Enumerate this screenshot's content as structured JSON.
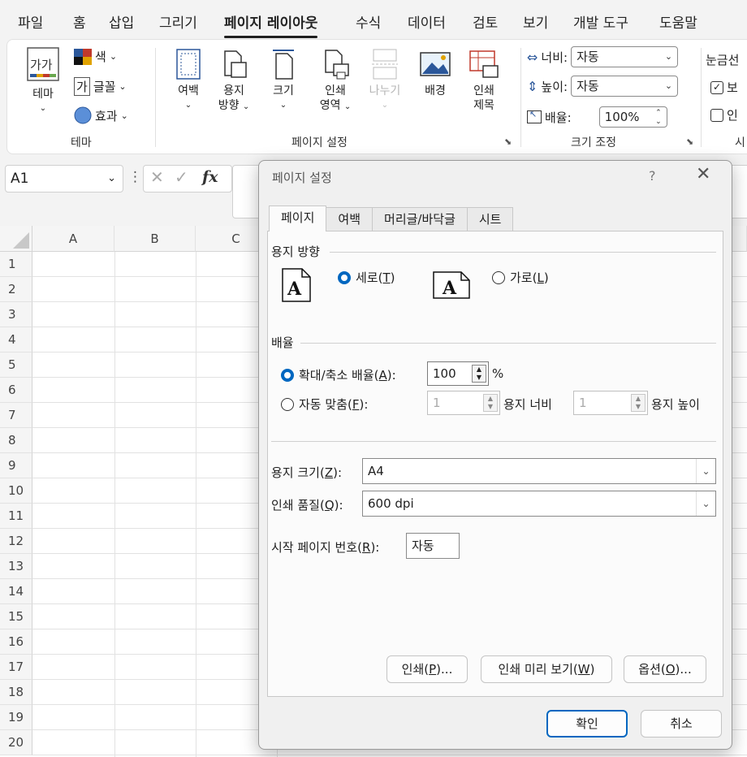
{
  "menu": {
    "items": [
      {
        "label": "파일",
        "active": false
      },
      {
        "label": "홈",
        "active": false
      },
      {
        "label": "삽입",
        "active": false
      },
      {
        "label": "그리기",
        "active": false
      },
      {
        "label": "페이지 레이아웃",
        "active": true
      },
      {
        "label": "수식",
        "active": false
      },
      {
        "label": "데이터",
        "active": false
      },
      {
        "label": "검토",
        "active": false
      },
      {
        "label": "보기",
        "active": false
      },
      {
        "label": "개발 도구",
        "active": false
      },
      {
        "label": "도움말",
        "active": false
      }
    ]
  },
  "ribbon": {
    "theme_group": {
      "label": "테마",
      "theme_button": "테마",
      "theme_icon_text": "가가",
      "colors": "색",
      "fonts": "글꼴",
      "fonts_icon_text": "가",
      "effects": "효과"
    },
    "page_setup_group": {
      "label": "페이지 설정",
      "margins": "여백",
      "orientation": [
        "용지",
        "방향"
      ],
      "size": "크기",
      "print_area": [
        "인쇄",
        "영역"
      ],
      "breaks": "나누기",
      "background": "배경",
      "print_titles": [
        "인쇄",
        "제목"
      ]
    },
    "scale_group": {
      "label": "크기 조정",
      "width_label": "너비:",
      "width_value": "자동",
      "height_label": "높이:",
      "height_value": "자동",
      "scale_label": "배율:",
      "scale_value": "100%"
    },
    "sheet_options_group": {
      "label": "시",
      "gridlines": "눈금선",
      "view": "보",
      "print": "인"
    }
  },
  "formula_bar": {
    "name_box": "A1",
    "fx": "fx"
  },
  "sheet": {
    "columns": [
      "A",
      "B",
      "C"
    ],
    "rows": [
      "1",
      "2",
      "3",
      "4",
      "5",
      "6",
      "7",
      "8",
      "9",
      "10",
      "11",
      "12",
      "13",
      "14",
      "15",
      "16",
      "17",
      "18",
      "19",
      "20"
    ]
  },
  "dialog": {
    "title": "페이지 설정",
    "help": "?",
    "close": "✕",
    "tabs": [
      {
        "label": "페이지",
        "active": true
      },
      {
        "label": "여백",
        "active": false
      },
      {
        "label": "머리글/바닥글",
        "active": false
      },
      {
        "label": "시트",
        "active": false
      }
    ],
    "orientation": {
      "title": "용지 방향",
      "portrait": "세로",
      "portrait_key": "T",
      "landscape": "가로",
      "landscape_key": "L",
      "icon_letter": "A",
      "selected": "portrait"
    },
    "scaling": {
      "title": "배율",
      "adjust_label": "확대/축소 배율",
      "adjust_key": "A",
      "adjust_value": "100",
      "percent": "%",
      "fit_label": "자동 맞춤",
      "fit_key": "F",
      "fit_wide_value": "1",
      "fit_wide_label": "용지 너비",
      "fit_tall_value": "1",
      "fit_tall_label": "용지 높이",
      "selected": "adjust"
    },
    "paper_size": {
      "label": "용지 크기",
      "key": "Z",
      "value": "A4"
    },
    "print_quality": {
      "label": "인쇄 품질",
      "key": "Q",
      "value": "600 dpi"
    },
    "first_page": {
      "label": "시작 페이지 번호",
      "key": "R",
      "value": "자동"
    },
    "buttons": {
      "print": "인쇄",
      "print_key": "P",
      "preview": "인쇄 미리 보기",
      "preview_key": "W",
      "options": "옵션",
      "options_key": "O",
      "ellipsis": "...",
      "ok": "확인",
      "cancel": "취소"
    },
    "colors": {
      "accent": "#0067c0"
    }
  }
}
